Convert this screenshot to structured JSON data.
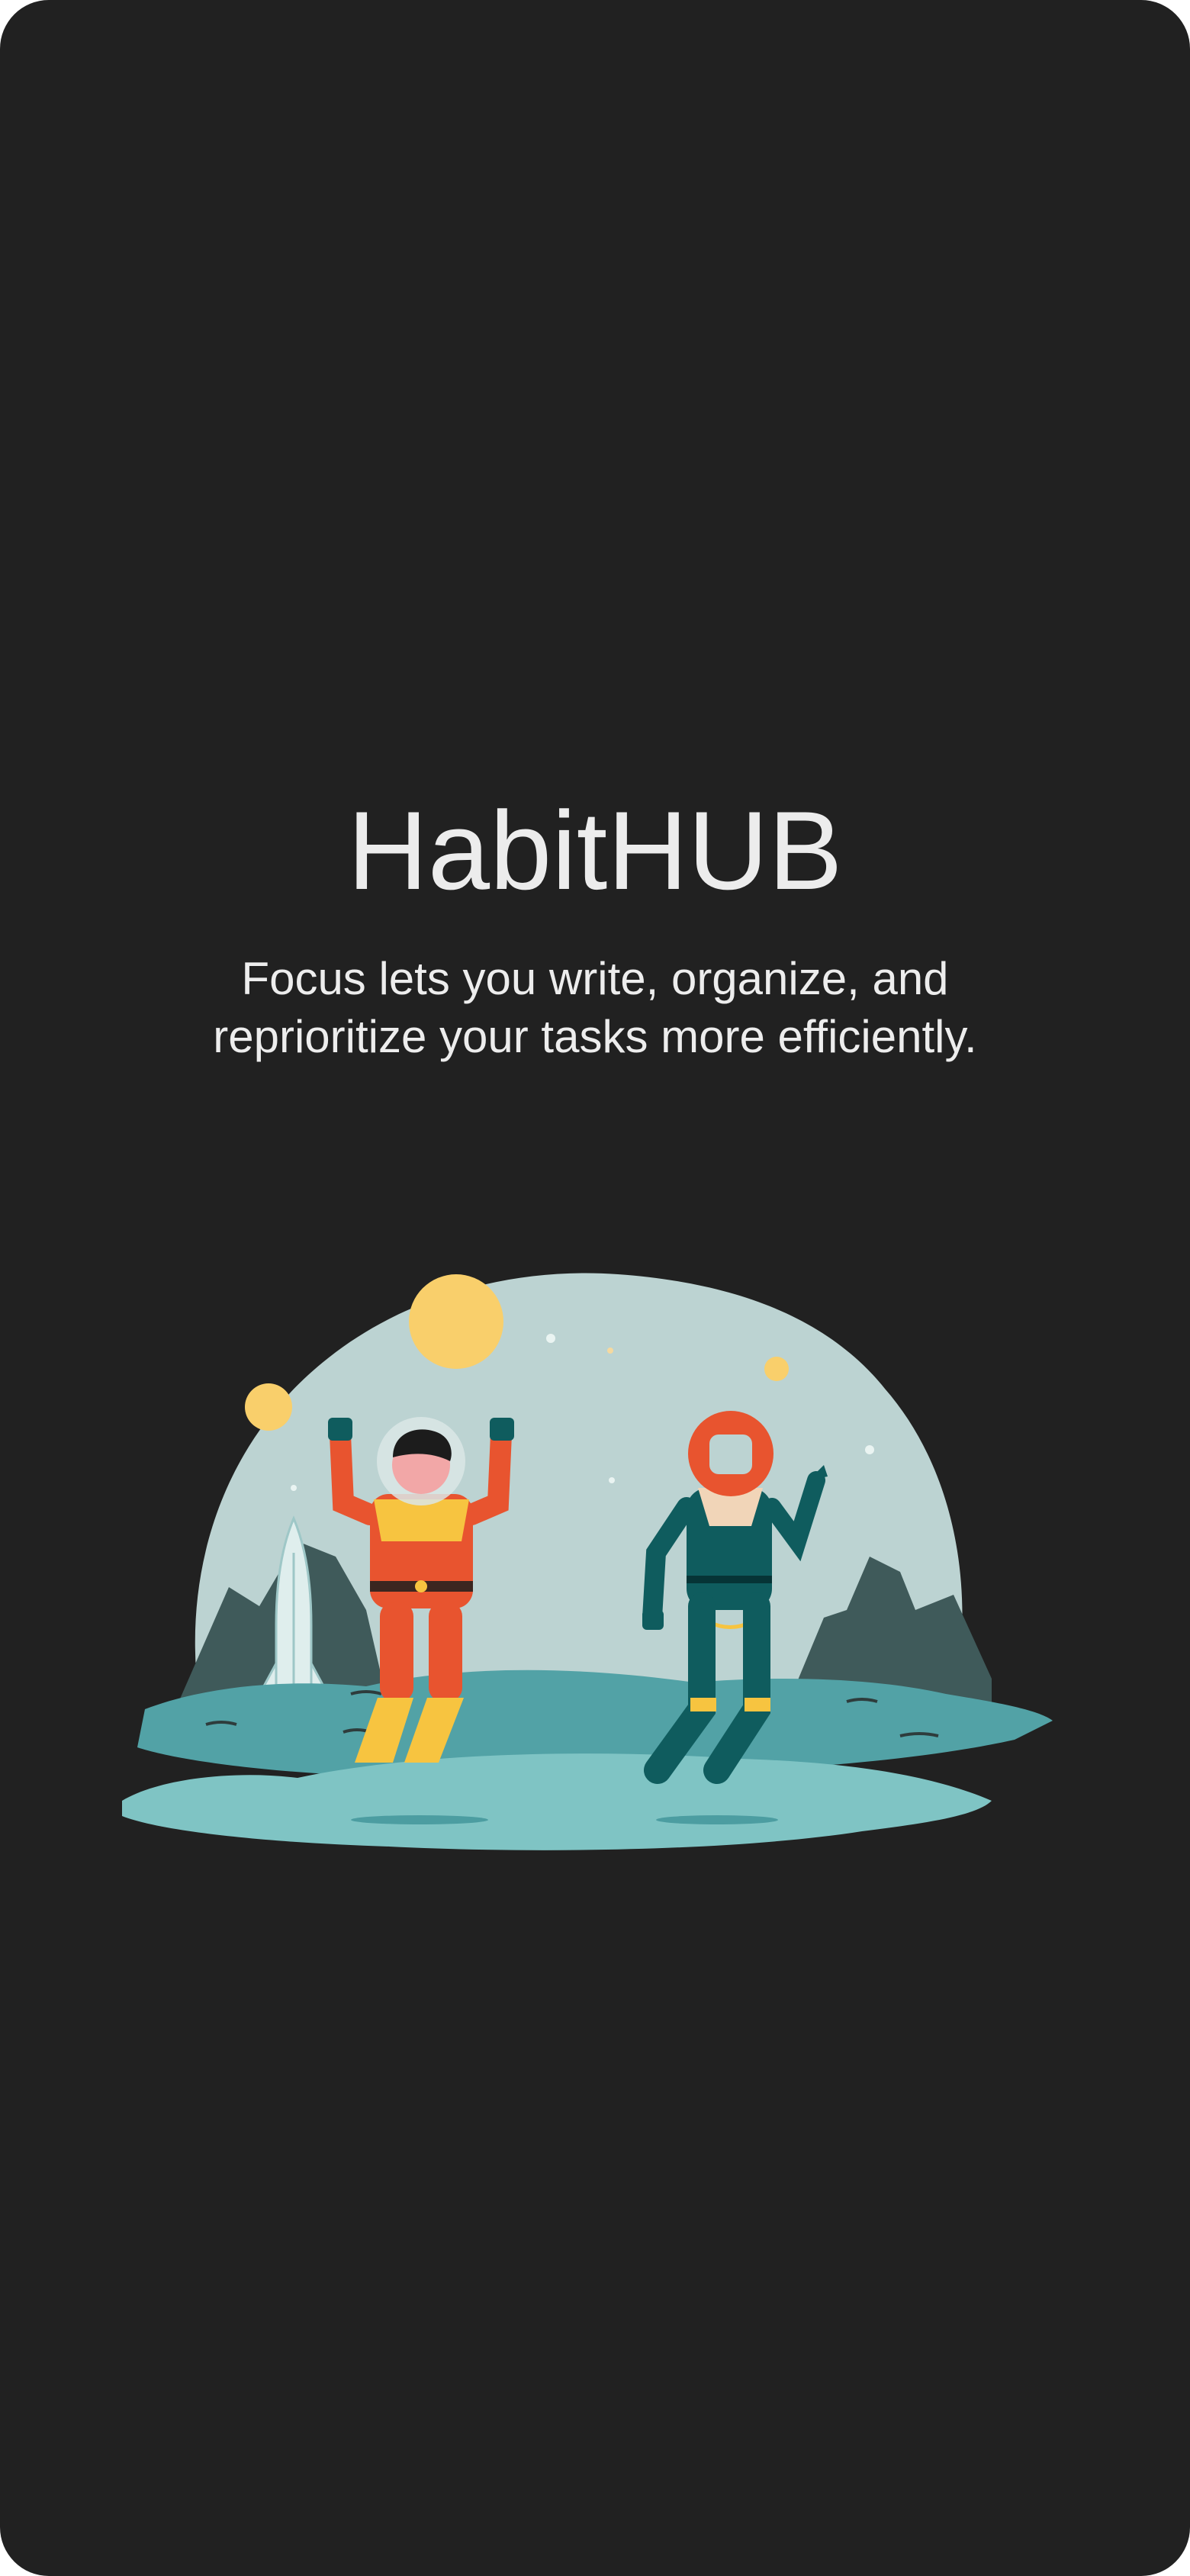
{
  "app": {
    "title": "HabitHUB",
    "tagline": "Focus lets you write, organize, and reprioritize your tasks more efficiently."
  },
  "illustration": {
    "subject": "two-astronauts-on-moon",
    "colors": {
      "background": "#212121",
      "sky": "#bcd3d2",
      "planet": "#f9cf6b",
      "ground_light": "#7fc4c4",
      "ground_mid": "#52a2a6",
      "mountain": "#3f5a5a",
      "orange_suit": "#e8542f",
      "teal_suit": "#0f5c5e",
      "yellow_accent": "#f7c440"
    }
  }
}
